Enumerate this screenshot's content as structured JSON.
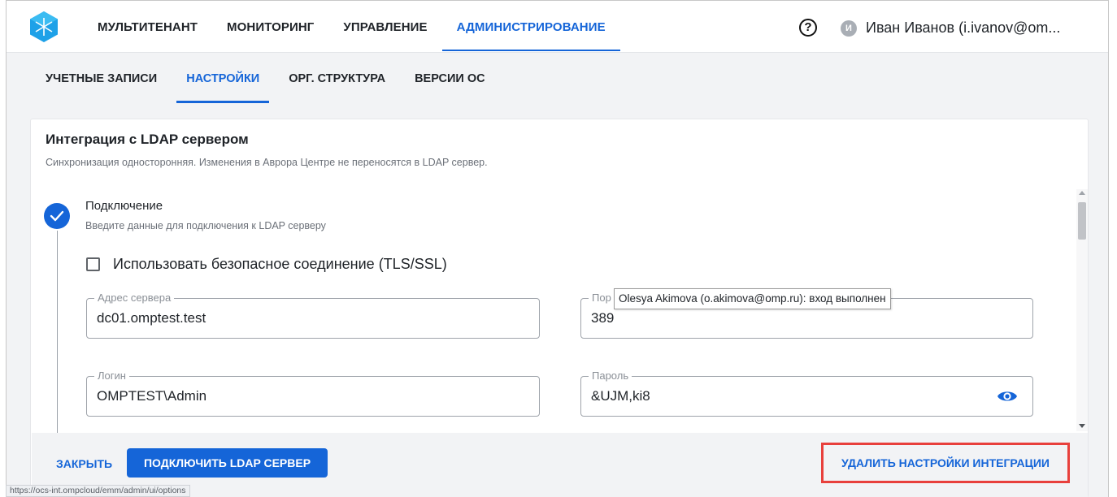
{
  "topnav": {
    "items": [
      "МУЛЬТИТЕНАНТ",
      "МОНИТОРИНГ",
      "УПРАВЛЕНИЕ",
      "АДМИНИСТРИРОВАНИЕ"
    ],
    "active_index": 3
  },
  "header": {
    "help_symbol": "?",
    "avatar_initial": "И",
    "user_name": "Иван Иванов (i.ivanov@om..."
  },
  "subnav": {
    "items": [
      "УЧЕТНЫЕ ЗАПИСИ",
      "НАСТРОЙКИ",
      "ОРГ. СТРУКТУРА",
      "ВЕРСИИ ОС"
    ],
    "active_index": 1
  },
  "card": {
    "title": "Интеграция с LDAP сервером",
    "subtitle": "Синхронизация односторонняя. Изменения в Аврора Центре не переносятся в LDAP сервер."
  },
  "step": {
    "title": "Подключение",
    "subtitle": "Введите данные для подключения к LDAP серверу"
  },
  "form": {
    "tls_label": "Использовать безопасное соединение (TLS/SSL)",
    "tls_checked": false,
    "server_label": "Адрес сервера",
    "server_value": "dc01.omptest.test",
    "port_label": "Пор",
    "port_value": "389",
    "login_label": "Логин",
    "login_value": "OMPTEST\\Admin",
    "password_label": "Пароль",
    "password_value": "&UJM,ki8"
  },
  "tooltip": "Olesya Akimova (o.akimova@omp.ru): вход выполнен",
  "footer": {
    "close_label": "ЗАКРЫТЬ",
    "connect_label": "ПОДКЛЮЧИТЬ LDAP СЕРВЕР",
    "delete_label": "УДАЛИТЬ НАСТРОЙКИ ИНТЕГРАЦИИ"
  },
  "status_url": "https://ocs-int.ompcloud/emm/admin/ui/options",
  "colors": {
    "accent": "#1565d8",
    "highlight_border": "#e8403c"
  }
}
